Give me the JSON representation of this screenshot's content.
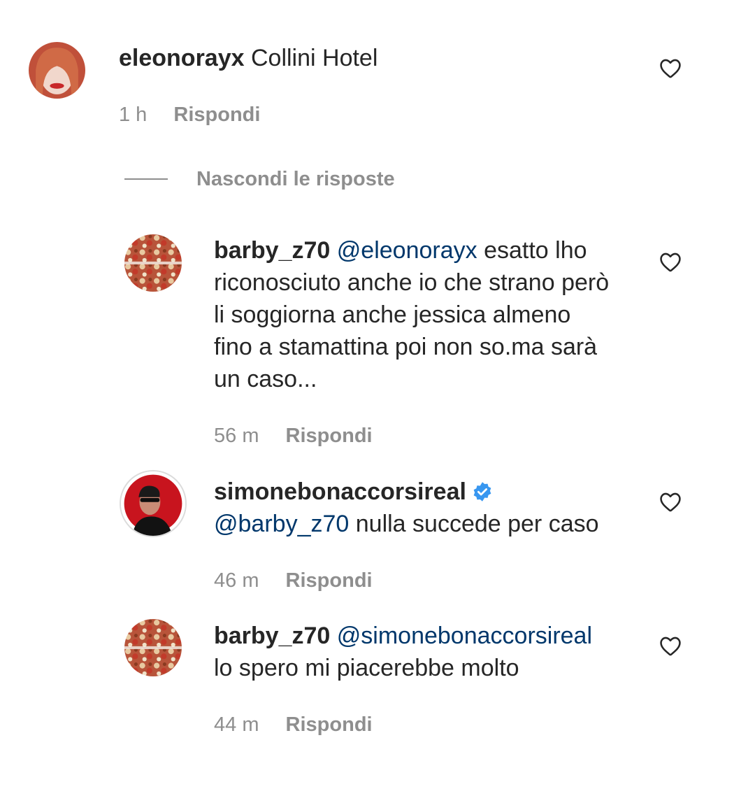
{
  "comments": [
    {
      "username": "eleonorayx",
      "text": "Collini Hotel",
      "time": "1 h",
      "reply_label": "Rispondi",
      "avatar": "avatar-red-hair-photo"
    }
  ],
  "hide_replies_label": "Nascondi le risposte",
  "replies": [
    {
      "username": "barby_z70",
      "mention": "@eleonorayx",
      "line1": "esatto lho",
      "line2": "riconosciuto anche io che strano però",
      "line3": "li soggiorna anche jessica almeno",
      "line4": "fino a stamattina poi non so.ma sarà",
      "line5": "un caso...",
      "time": "56 m",
      "reply_label": "Rispondi",
      "avatar": "avatar-floral-pattern"
    },
    {
      "username": "simonebonaccorsireal",
      "verified": true,
      "mention": "@barby_z70",
      "text": "nulla succede per caso",
      "time": "46 m",
      "reply_label": "Rispondi",
      "avatar": "avatar-man-sunglasses-red"
    },
    {
      "username": "barby_z70",
      "mention": "@simonebonaccorsireal",
      "text": "lo spero mi piacerebbe molto",
      "time": "44 m",
      "reply_label": "Rispondi",
      "avatar": "avatar-floral-pattern"
    }
  ],
  "colors": {
    "text": "#262626",
    "secondary": "#8e8e8e",
    "mention": "#00376b",
    "verified": "#3897f0"
  },
  "icons": {
    "like": "heart-outline-icon",
    "verified": "verified-badge-icon"
  }
}
